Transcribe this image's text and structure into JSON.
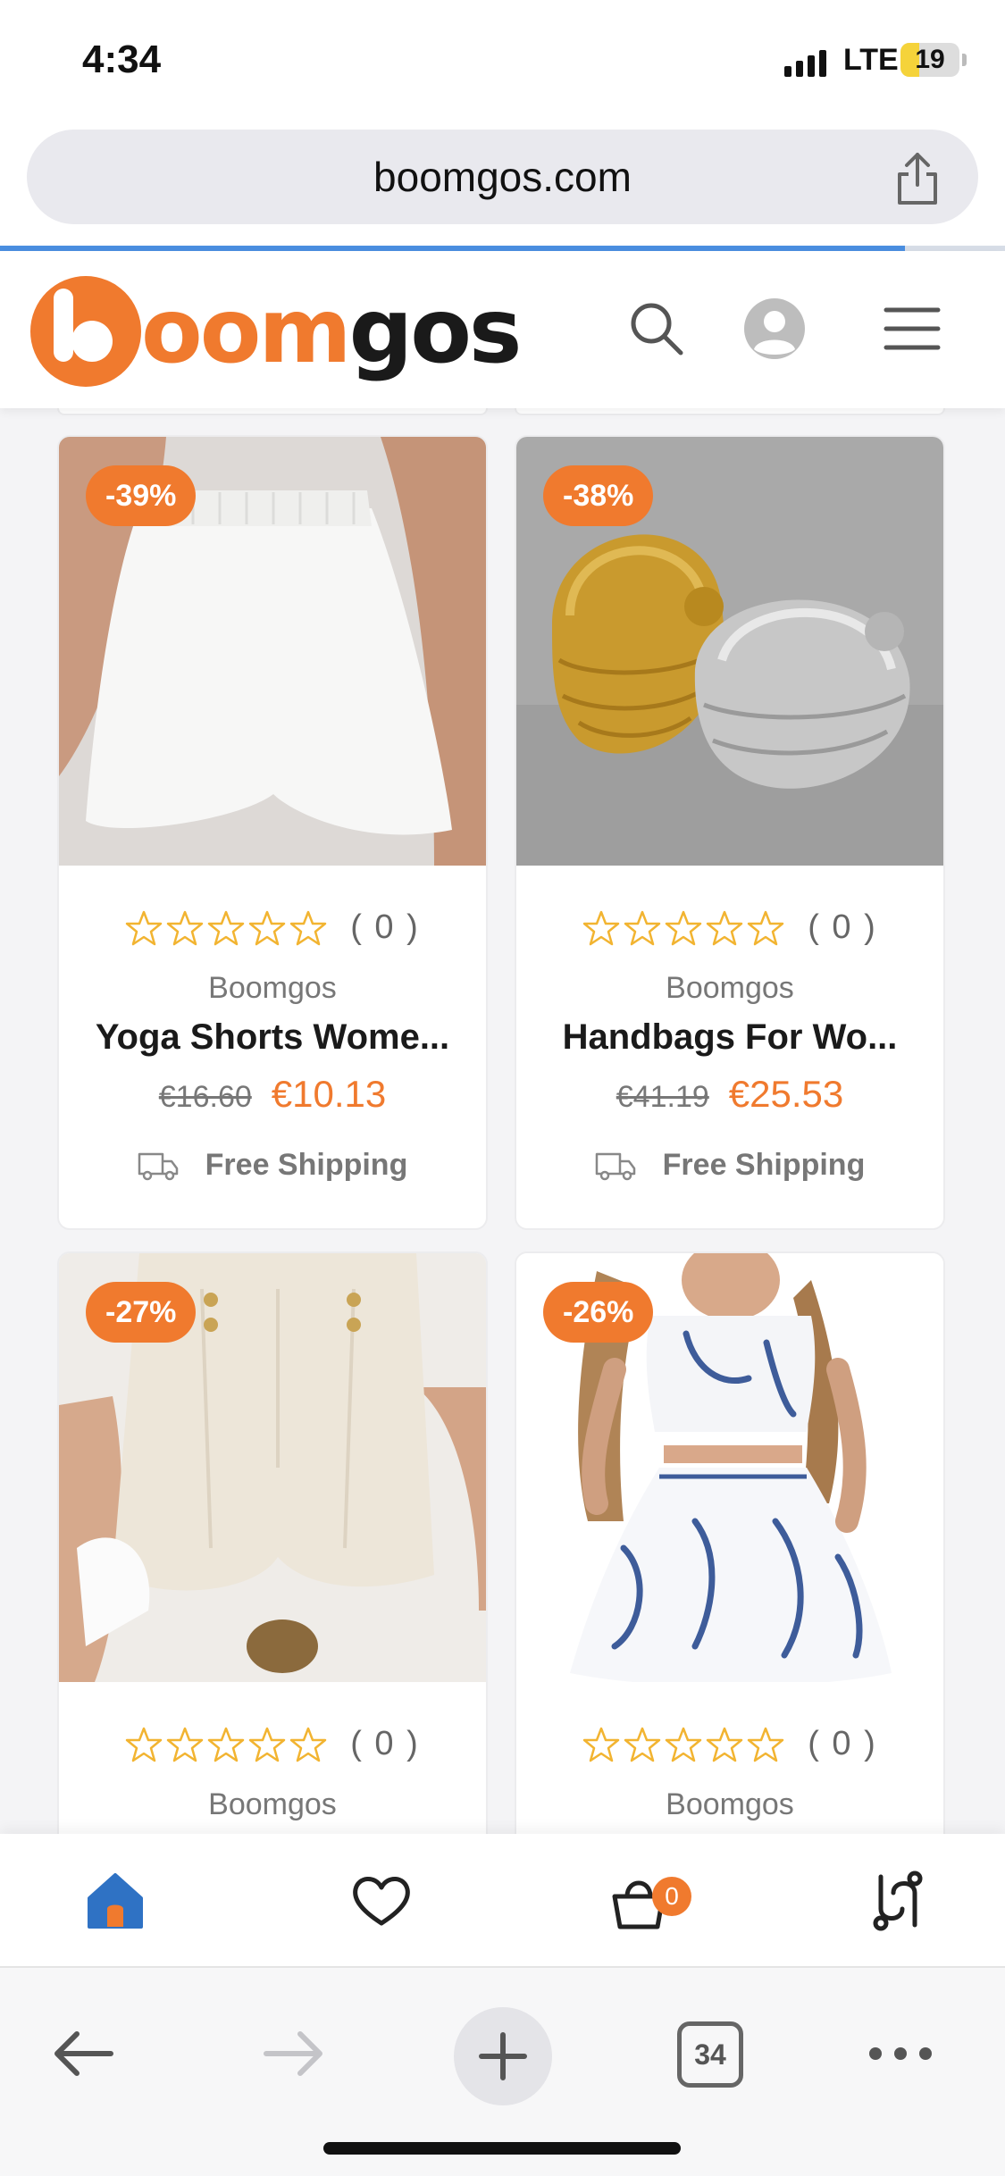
{
  "status_bar": {
    "time": "4:34",
    "network": "LTE",
    "battery": "19"
  },
  "browser": {
    "url": "boomgos.com",
    "open_tabs": "34"
  },
  "site": {
    "brand_letters_orange": "oom",
    "brand_letters_dark": "gos"
  },
  "products": [
    {
      "discount": "-39%",
      "rating_count": "( 0 )",
      "brand": "Boomgos",
      "name": "Yoga Shorts Wome...",
      "old_price": "€16.60",
      "price": "€10.13",
      "shipping": "Free Shipping"
    },
    {
      "discount": "-38%",
      "rating_count": "( 0 )",
      "brand": "Boomgos",
      "name": "Handbags For Wo...",
      "old_price": "€41.19",
      "price": "€25.53",
      "shipping": "Free Shipping"
    },
    {
      "discount": "-27%",
      "rating_count": "( 0 )",
      "brand": "Boomgos",
      "name": "",
      "old_price": "",
      "price": "",
      "shipping": ""
    },
    {
      "discount": "-26%",
      "rating_count": "( 0 )",
      "brand": "Boomgos",
      "name": "",
      "old_price": "",
      "price": "",
      "shipping": ""
    }
  ],
  "bottom_nav": {
    "cart_count": "0"
  },
  "icons": {
    "header": [
      "search-icon",
      "account-icon",
      "menu-icon"
    ],
    "bottom_nav": [
      "home-icon",
      "wishlist-icon",
      "cart-icon",
      "compare-icon"
    ],
    "toolbar": [
      "back-icon",
      "forward-icon",
      "new-tab-icon",
      "tabs-icon",
      "more-icon"
    ]
  },
  "colors": {
    "accent": "#f07a2e",
    "link_blue": "#2f72c4",
    "star": "#f2b431"
  }
}
